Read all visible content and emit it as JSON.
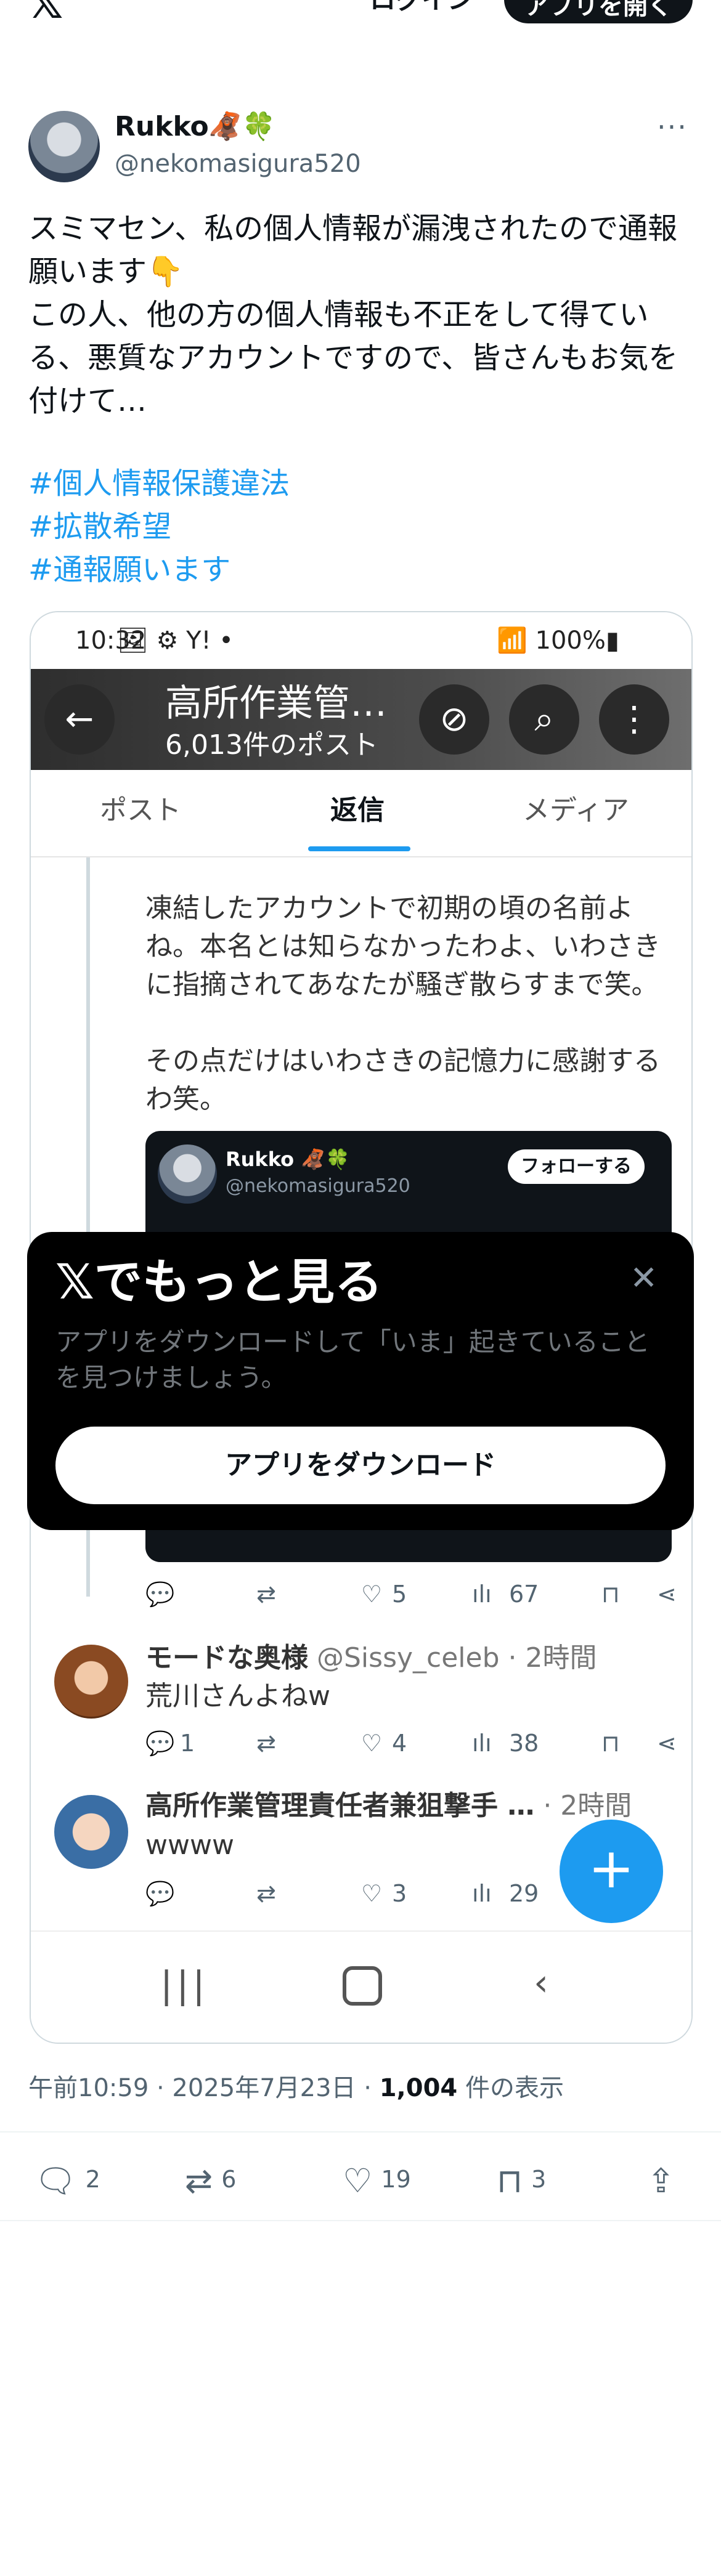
{
  "topbar": {
    "logo": "𝕏",
    "login": "ログイン",
    "open_app": "アプリを開く"
  },
  "author": {
    "name": "Rukko",
    "emoji": "🦧🍀",
    "handle": "@nekomasigura520",
    "more": "···"
  },
  "tweet": {
    "text": "スミマセン、私の個人情報が漏洩されたので通報\n願います👇\nこの人、他の方の個人情報も不正をして得てい\nる、悪質なアカウントですので、皆さんもお気を\n付けて…",
    "hashtags": [
      "#個人情報保護違法",
      "#拡散希望",
      "#通報願います"
    ]
  },
  "screenshot": {
    "status_time": "10:32",
    "status_icons": "🖼 ⚙ Y! •",
    "status_battery": "100%",
    "header_title": "高所作業管…",
    "header_subtitle": "6,013件のポスト",
    "tabs": [
      "ポスト",
      "返信",
      "メディア"
    ],
    "reply_body": "凍結したアカウントで初期の頃の名前よ\nね。本名とは知らなかったわよ、いわさき\nに指摘されてあなたが騒ぎ散らすまで笑。\n\nその点だけはいわさきの記憶力に感謝する\nわ笑。",
    "embedded": {
      "name": "Rukko 🦧🍀",
      "handle": "@nekomasigura520",
      "follow": "フォローする"
    },
    "row1": {
      "likes": "5",
      "views": "67"
    },
    "reply2": {
      "name": "モードな奥様",
      "handle": "@Sissy_celeb · 2時間",
      "text": "荒川さんよねw",
      "replies": "1",
      "likes": "4",
      "views": "38"
    },
    "reply3": {
      "name": "高所作業管理責任者兼狙撃手 …",
      "time": "· 2時間",
      "text": "wwww",
      "likes": "3",
      "views": "29"
    },
    "fab": "+"
  },
  "overlay": {
    "title": "𝕏でもっと見る",
    "close": "✕",
    "description": "アプリをダウンロードして「いま」起きていること\nを見つけましょう。",
    "button": "アプリをダウンロード"
  },
  "meta": {
    "time": "午前10:59 · 2025年7月23日 · ",
    "views": "1,004",
    "views_label": " 件の表示"
  },
  "actions": {
    "replies": "2",
    "reposts": "6",
    "likes": "19",
    "bookmarks": "3"
  }
}
